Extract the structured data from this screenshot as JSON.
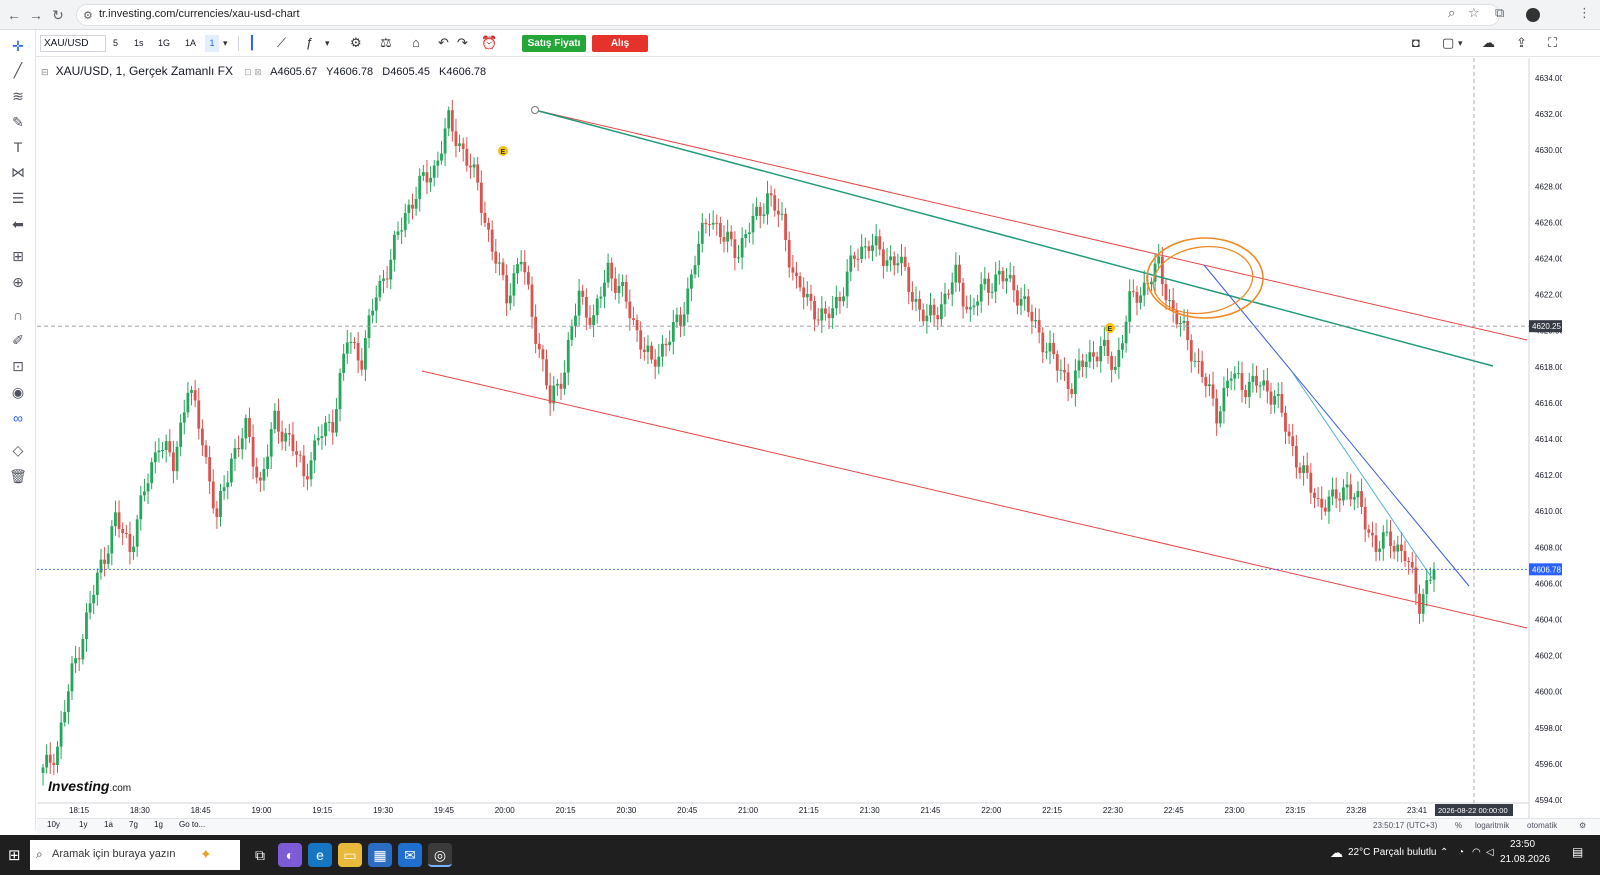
{
  "browser": {
    "url": "tr.investing.com/currencies/xau-usd-chart",
    "back_icon": "arrow-left-icon",
    "forward_icon": "arrow-right-icon",
    "reload_icon": "reload-icon"
  },
  "toolbar": {
    "symbol": "XAU/USD",
    "timeframes": [
      "5",
      "1s",
      "1G",
      "1A",
      "1"
    ],
    "active_timeframe": "1",
    "sell_label": "Satış Fiyatı",
    "buy_label": "Alış",
    "sell_color": "#24a638",
    "buy_color": "#e5322b"
  },
  "legend": {
    "title": "XAU/USD, 1, Gerçek Zamanlı FX",
    "open": "A4605.67",
    "high": "Y4606.78",
    "low": "D4605.45",
    "close": "K4606.78"
  },
  "chart_data": {
    "type": "candlestick",
    "y_range": [
      4594,
      4635
    ],
    "y_ticks": [
      "4634.00",
      "4632.00",
      "4630.00",
      "4628.00",
      "4626.00",
      "4624.00",
      "4622.00",
      "4620.00",
      "4618.00",
      "4616.00",
      "4614.00",
      "4612.00",
      "4610.00",
      "4608.00",
      "4606.00",
      "4604.00",
      "4602.00",
      "4600.00",
      "4598.00",
      "4596.00",
      "4594.00"
    ],
    "x_ticks": [
      "18:15",
      "18:30",
      "18:45",
      "19:00",
      "19:15",
      "19:30",
      "19:45",
      "20:00",
      "20:15",
      "20:30",
      "20:45",
      "21:00",
      "21:15",
      "21:30",
      "21:45",
      "22:00",
      "22:15",
      "22:30",
      "22:45",
      "23:00",
      "23:15",
      "23:28",
      "23:41"
    ],
    "current_price": "4606.78",
    "crosshair_price": "4620.25",
    "crosshair_date": "2026-08-22 00:00:00",
    "up_color": "#26a65b",
    "down_color": "#d9534f",
    "price_path": [
      [
        0,
        4595.5
      ],
      [
        4,
        4597
      ],
      [
        8,
        4601
      ],
      [
        12,
        4604
      ],
      [
        16,
        4607
      ],
      [
        20,
        4609.5
      ],
      [
        24,
        4608
      ],
      [
        28,
        4611
      ],
      [
        32,
        4614
      ],
      [
        36,
        4612.5
      ],
      [
        40,
        4617
      ],
      [
        44,
        4614
      ],
      [
        48,
        4609.5
      ],
      [
        52,
        4613
      ],
      [
        56,
        4614.5
      ],
      [
        60,
        4611.5
      ],
      [
        64,
        4615
      ],
      [
        68,
        4614
      ],
      [
        72,
        4612
      ],
      [
        76,
        4614
      ],
      [
        80,
        4615
      ],
      [
        84,
        4619.5
      ],
      [
        88,
        4618.5
      ],
      [
        92,
        4622
      ],
      [
        96,
        4624
      ],
      [
        100,
        4626.5
      ],
      [
        104,
        4628
      ],
      [
        108,
        4629
      ],
      [
        112,
        4631.5
      ],
      [
        116,
        4630
      ],
      [
        120,
        4628
      ],
      [
        124,
        4624.5
      ],
      [
        128,
        4622
      ],
      [
        132,
        4624
      ],
      [
        136,
        4620
      ],
      [
        140,
        4616
      ],
      [
        144,
        4618
      ],
      [
        148,
        4622
      ],
      [
        152,
        4620.5
      ],
      [
        156,
        4623.5
      ],
      [
        160,
        4622
      ],
      [
        164,
        4620
      ],
      [
        168,
        4618
      ],
      [
        172,
        4619.5
      ],
      [
        176,
        4620.5
      ],
      [
        180,
        4624
      ],
      [
        184,
        4626.5
      ],
      [
        188,
        4625
      ],
      [
        192,
        4624.5
      ],
      [
        196,
        4626
      ],
      [
        200,
        4627.5
      ],
      [
        204,
        4626
      ],
      [
        208,
        4622.5
      ],
      [
        212,
        4621.5
      ],
      [
        216,
        4620.5
      ],
      [
        220,
        4622
      ],
      [
        224,
        4624
      ],
      [
        228,
        4625
      ],
      [
        232,
        4624
      ],
      [
        236,
        4624
      ],
      [
        240,
        4622
      ],
      [
        244,
        4620.5
      ],
      [
        248,
        4621.5
      ],
      [
        252,
        4623
      ],
      [
        256,
        4621
      ],
      [
        260,
        4622.5
      ],
      [
        264,
        4623
      ],
      [
        268,
        4622.5
      ],
      [
        272,
        4621
      ],
      [
        276,
        4619.5
      ],
      [
        280,
        4618
      ],
      [
        284,
        4617
      ],
      [
        288,
        4618.5
      ],
      [
        292,
        4619
      ],
      [
        296,
        4618
      ],
      [
        300,
        4621.5
      ],
      [
        304,
        4622.5
      ],
      [
        308,
        4623.5
      ],
      [
        312,
        4621
      ],
      [
        316,
        4619.5
      ],
      [
        320,
        4617.5
      ],
      [
        324,
        4615.5
      ],
      [
        328,
        4617.5
      ],
      [
        332,
        4617
      ],
      [
        336,
        4617
      ],
      [
        340,
        4616.5
      ],
      [
        344,
        4614
      ],
      [
        348,
        4612
      ],
      [
        352,
        4610.5
      ],
      [
        356,
        4610.5
      ],
      [
        360,
        4611.5
      ],
      [
        364,
        4610
      ],
      [
        368,
        4608
      ],
      [
        372,
        4608.5
      ],
      [
        376,
        4607.5
      ],
      [
        380,
        4605
      ],
      [
        384,
        4606.78
      ]
    ],
    "annotations": [
      {
        "label": "E",
        "color": "#f2c00f"
      },
      {
        "label": "E",
        "color": "#f2c00f"
      }
    ]
  },
  "bottom_bar": {
    "ranges": [
      "10y",
      "1y",
      "1a",
      "7g",
      "1g",
      "Go to..."
    ],
    "clock": "23:50:17 (UTC+3)",
    "percent": "%",
    "log": "logaritmik",
    "auto": "otomatik"
  },
  "taskbar": {
    "search_placeholder": "Aramak için buraya yazın",
    "weather": "22°C  Parçalı bulutlu",
    "time": "23:50",
    "date": "21.08.2026"
  },
  "brand": {
    "logo_text": "Investing",
    "logo_suffix": ".com"
  }
}
